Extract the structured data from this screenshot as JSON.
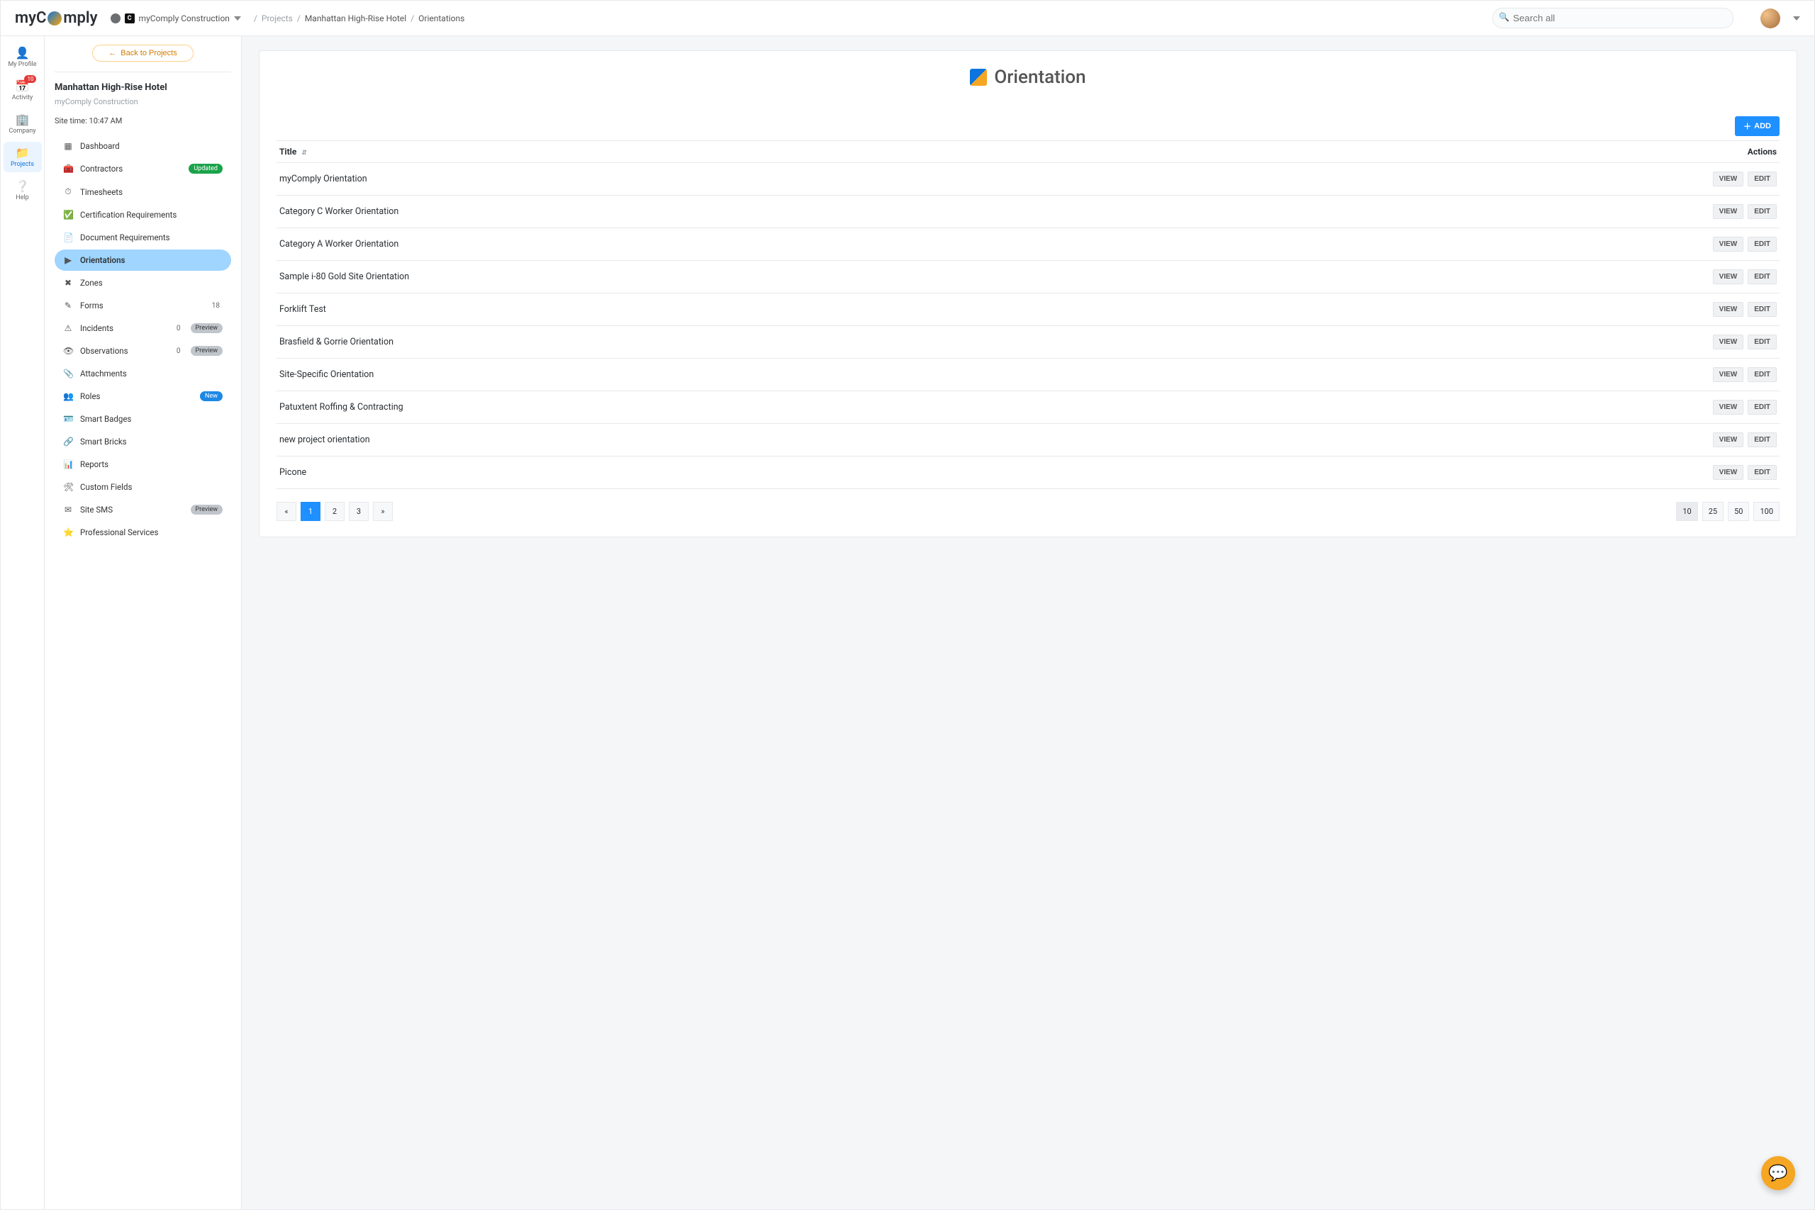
{
  "logo": {
    "pre": "myC",
    "post": "mply"
  },
  "company": {
    "name": "myComply Construction"
  },
  "breadcrumb": {
    "a": "Projects",
    "b": "Manhattan High-Rise Hotel",
    "c": "Orientations"
  },
  "search": {
    "placeholder": "Search all"
  },
  "rail": {
    "items": [
      {
        "label": "My Profile",
        "badge": ""
      },
      {
        "label": "Activity",
        "badge": "10"
      },
      {
        "label": "Company",
        "badge": ""
      },
      {
        "label": "Projects",
        "badge": ""
      },
      {
        "label": "Help",
        "badge": ""
      }
    ]
  },
  "sidenav": {
    "back": "Back to Projects",
    "project_title": "Manhattan High-Rise Hotel",
    "project_sub": "myComply Construction",
    "site_time": "Site time: 10:47 AM",
    "items": [
      {
        "label": "Dashboard"
      },
      {
        "label": "Contractors",
        "pill": "Updated",
        "pill_cls": "green"
      },
      {
        "label": "Timesheets"
      },
      {
        "label": "Certification Requirements"
      },
      {
        "label": "Document Requirements"
      },
      {
        "label": "Orientations",
        "active": true
      },
      {
        "label": "Zones"
      },
      {
        "label": "Forms",
        "count": "18"
      },
      {
        "label": "Incidents",
        "count": "0",
        "pill": "Preview",
        "pill_cls": "gray"
      },
      {
        "label": "Observations",
        "count": "0",
        "pill": "Preview",
        "pill_cls": "gray"
      },
      {
        "label": "Attachments"
      },
      {
        "label": "Roles",
        "pill": "New",
        "pill_cls": "blue"
      },
      {
        "label": "Smart Badges"
      },
      {
        "label": "Smart Bricks"
      },
      {
        "label": "Reports"
      },
      {
        "label": "Custom Fields"
      },
      {
        "label": "Site SMS",
        "pill": "Preview",
        "pill_cls": "gray"
      },
      {
        "label": "Professional Services"
      }
    ]
  },
  "page": {
    "title": "Orientation",
    "add": "ADD",
    "col_title": "Title",
    "col_actions": "Actions",
    "view": "VIEW",
    "edit": "EDIT",
    "rows": [
      "myComply Orientation",
      "Category C Worker Orientation",
      "Category A Worker Orientation",
      "Sample i-80 Gold Site Orientation",
      "Forklift Test",
      "Brasfield & Gorrie Orientation",
      "Site-Specific Orientation",
      "Patuxtent Roffing & Contracting",
      "new project orientation",
      "Picone"
    ],
    "pager": {
      "prev": "«",
      "pages": [
        "1",
        "2",
        "3"
      ],
      "next": "»",
      "active": "1"
    },
    "sizes": [
      "10",
      "25",
      "50",
      "100"
    ],
    "size_active": "10"
  }
}
